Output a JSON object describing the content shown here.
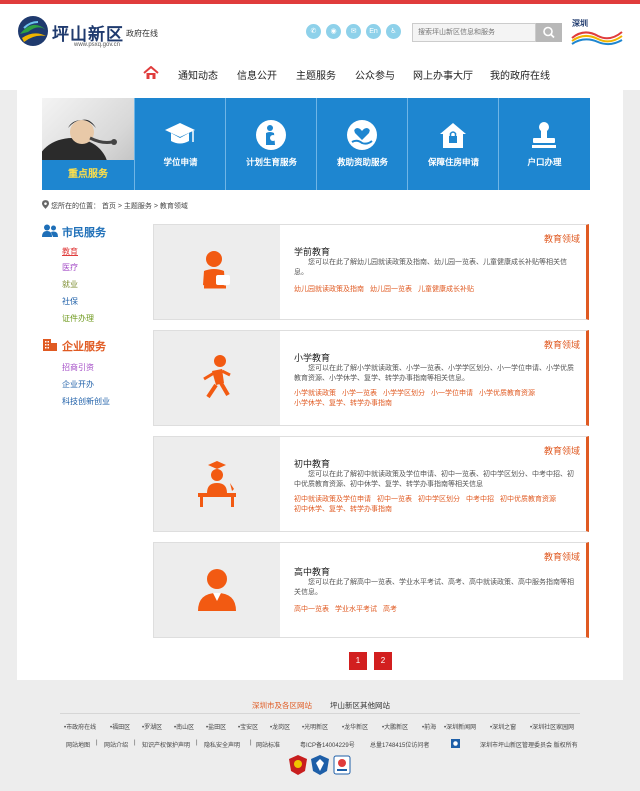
{
  "header": {
    "site_name": "坪山新区",
    "site_sub": "政府在线",
    "site_url": "www.psxq.gov.cn",
    "tools": [
      {
        "icon": "phone-icon",
        "glyph": "✆"
      },
      {
        "icon": "weibo-icon",
        "glyph": "◉"
      },
      {
        "icon": "wechat-icon",
        "glyph": "✉"
      },
      {
        "icon": "english-icon",
        "glyph": "En"
      },
      {
        "icon": "accessibility-icon",
        "glyph": "♿"
      }
    ],
    "search_placeholder": "搜索坪山新区信息和服务",
    "brand_right": "深圳"
  },
  "nav": {
    "items": [
      "通知动态",
      "信息公开",
      "主题服务",
      "公众参与",
      "网上办事大厅",
      "我的政府在线"
    ]
  },
  "banner": {
    "photo_label": "重点服务",
    "tiles": [
      {
        "label": "学位申请",
        "icon": "graduation-cap-icon"
      },
      {
        "label": "计划生育服务",
        "icon": "family-planning-icon"
      },
      {
        "label": "救助资助服务",
        "icon": "heart-hand-icon"
      },
      {
        "label": "保障住房申请",
        "icon": "house-lock-icon"
      },
      {
        "label": "户口办理",
        "icon": "stamp-icon"
      }
    ]
  },
  "breadcrumb": {
    "prefix": "您所在的位置：",
    "items": [
      "首页",
      ">",
      "主题服务",
      ">",
      "教育领域"
    ]
  },
  "sidebar": {
    "citizen": {
      "title": "市民服务",
      "links": [
        {
          "label": "教育",
          "color": "#e03c3c"
        },
        {
          "label": "医疗",
          "color": "#a44ec7"
        },
        {
          "label": "就业",
          "color": "#7a8a2a"
        },
        {
          "label": "社保",
          "color": "#1e5fa8"
        },
        {
          "label": "证件办理",
          "color": "#6f9a1e"
        }
      ]
    },
    "business": {
      "title": "企业服务",
      "links": [
        {
          "label": "招商引资",
          "color": "#a44ec7"
        },
        {
          "label": "企业开办",
          "color": "#1e5fa8"
        },
        {
          "label": "科技创新创业",
          "color": "#1e5fa8"
        }
      ]
    }
  },
  "cards": [
    {
      "tag": "教育领域",
      "title": "学前教育",
      "icon": "preschool-child-icon",
      "desc": "您可以在此了解幼儿园就读政策及指南、幼儿园一览表、儿童健康成长补贴等相关信息。",
      "links": [
        "幼儿园就读政策及指南",
        "幼儿园一览表",
        "儿童健康成长补贴"
      ]
    },
    {
      "tag": "教育领域",
      "title": "小学教育",
      "icon": "running-student-icon",
      "desc": "您可以在此了解小学就读政策、小学一览表、小学学区划分、小一学位申请、小学优质教育资源、小学休学、复学、转学办事指南等相关信息。",
      "links": [
        "小学就读政策",
        "小学一览表",
        "小学学区划分",
        "小一学位申请",
        "小学优质教育资源",
        "小学休学、复学、转学办事指南"
      ]
    },
    {
      "tag": "教育领域",
      "title": "初中教育",
      "icon": "student-desk-icon",
      "desc": "您可以在此了解初中就读政策及学位申请、初中一览表、初中学区划分、中考中招、初中优质教育资源、初中休学、复学、转学办事指南等相关信息",
      "links": [
        "初中就读政策及学位申请",
        "初中一览表",
        "初中学区划分",
        "中考中招",
        "初中优质教育资源",
        "初中休学、复学、转学办事指南"
      ]
    },
    {
      "tag": "教育领域",
      "title": "高中教育",
      "icon": "student-portrait-icon",
      "desc": "您可以在此了解高中一览表、学业水平考试、高考、高中就读政策、高中服务指南等相关信息。",
      "links": [
        "高中一览表",
        "学业水平考试",
        "高考"
      ]
    }
  ],
  "pager": {
    "pages": [
      "1",
      "2"
    ]
  },
  "footer": {
    "tabs": [
      {
        "label": "深圳市及各区网站",
        "color": "#e05a22"
      },
      {
        "label": "坪山新区其他网站",
        "color": "#333333"
      }
    ],
    "districts": [
      "•市政府在线",
      "•福田区",
      "•罗湖区",
      "•南山区",
      "•盐田区",
      "•宝安区",
      "•龙岗区",
      "•光明新区",
      "•龙华新区",
      "•大鹏新区",
      "•前海",
      "•深圳新闻网",
      "•深圳之窗",
      "•深圳社区家园网"
    ],
    "info": [
      "网站地图",
      "网站介绍",
      "知识产权保护声明",
      "隐私安全声明",
      "网站标准",
      "粤ICP备14004229号",
      "总量1748415位访问者",
      "深圳市坪山新区管理委员会 版权所有"
    ],
    "separators": [
      "|",
      "|",
      "|",
      "|"
    ],
    "badges": [
      "party-badge-icon",
      "police-badge-icon",
      "commerce-badge-icon"
    ]
  },
  "colors": {
    "accent": "#e05a22",
    "banner": "#1e86d0",
    "topbar": "#e03c3c",
    "pager": "#d21f1f"
  }
}
